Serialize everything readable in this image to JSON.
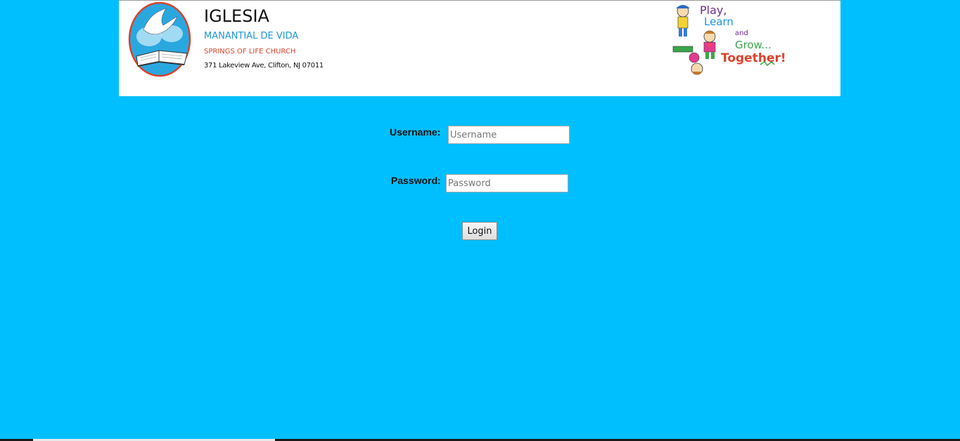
{
  "header": {
    "church_title": "IGLESIA",
    "church_subtitle": "MANANTIAL DE VIDA",
    "church_english": "SPRINGS OF LIFE CHURCH",
    "church_address": "371 Lakeview Ave, Clifton, NJ 07011",
    "slogan_lines": [
      "Play,",
      "Learn",
      "and",
      "Grow...",
      "Together!"
    ]
  },
  "login_form": {
    "username_label": "Username:",
    "username_placeholder": "Username",
    "username_value": "",
    "password_label": "Password:",
    "password_placeholder": "Password",
    "password_value": "",
    "login_button": "Login"
  },
  "colors": {
    "background": "#00bfff",
    "header_background": "#ffffff",
    "accent_blue": "#1e96d8",
    "accent_red": "#d9422b"
  }
}
